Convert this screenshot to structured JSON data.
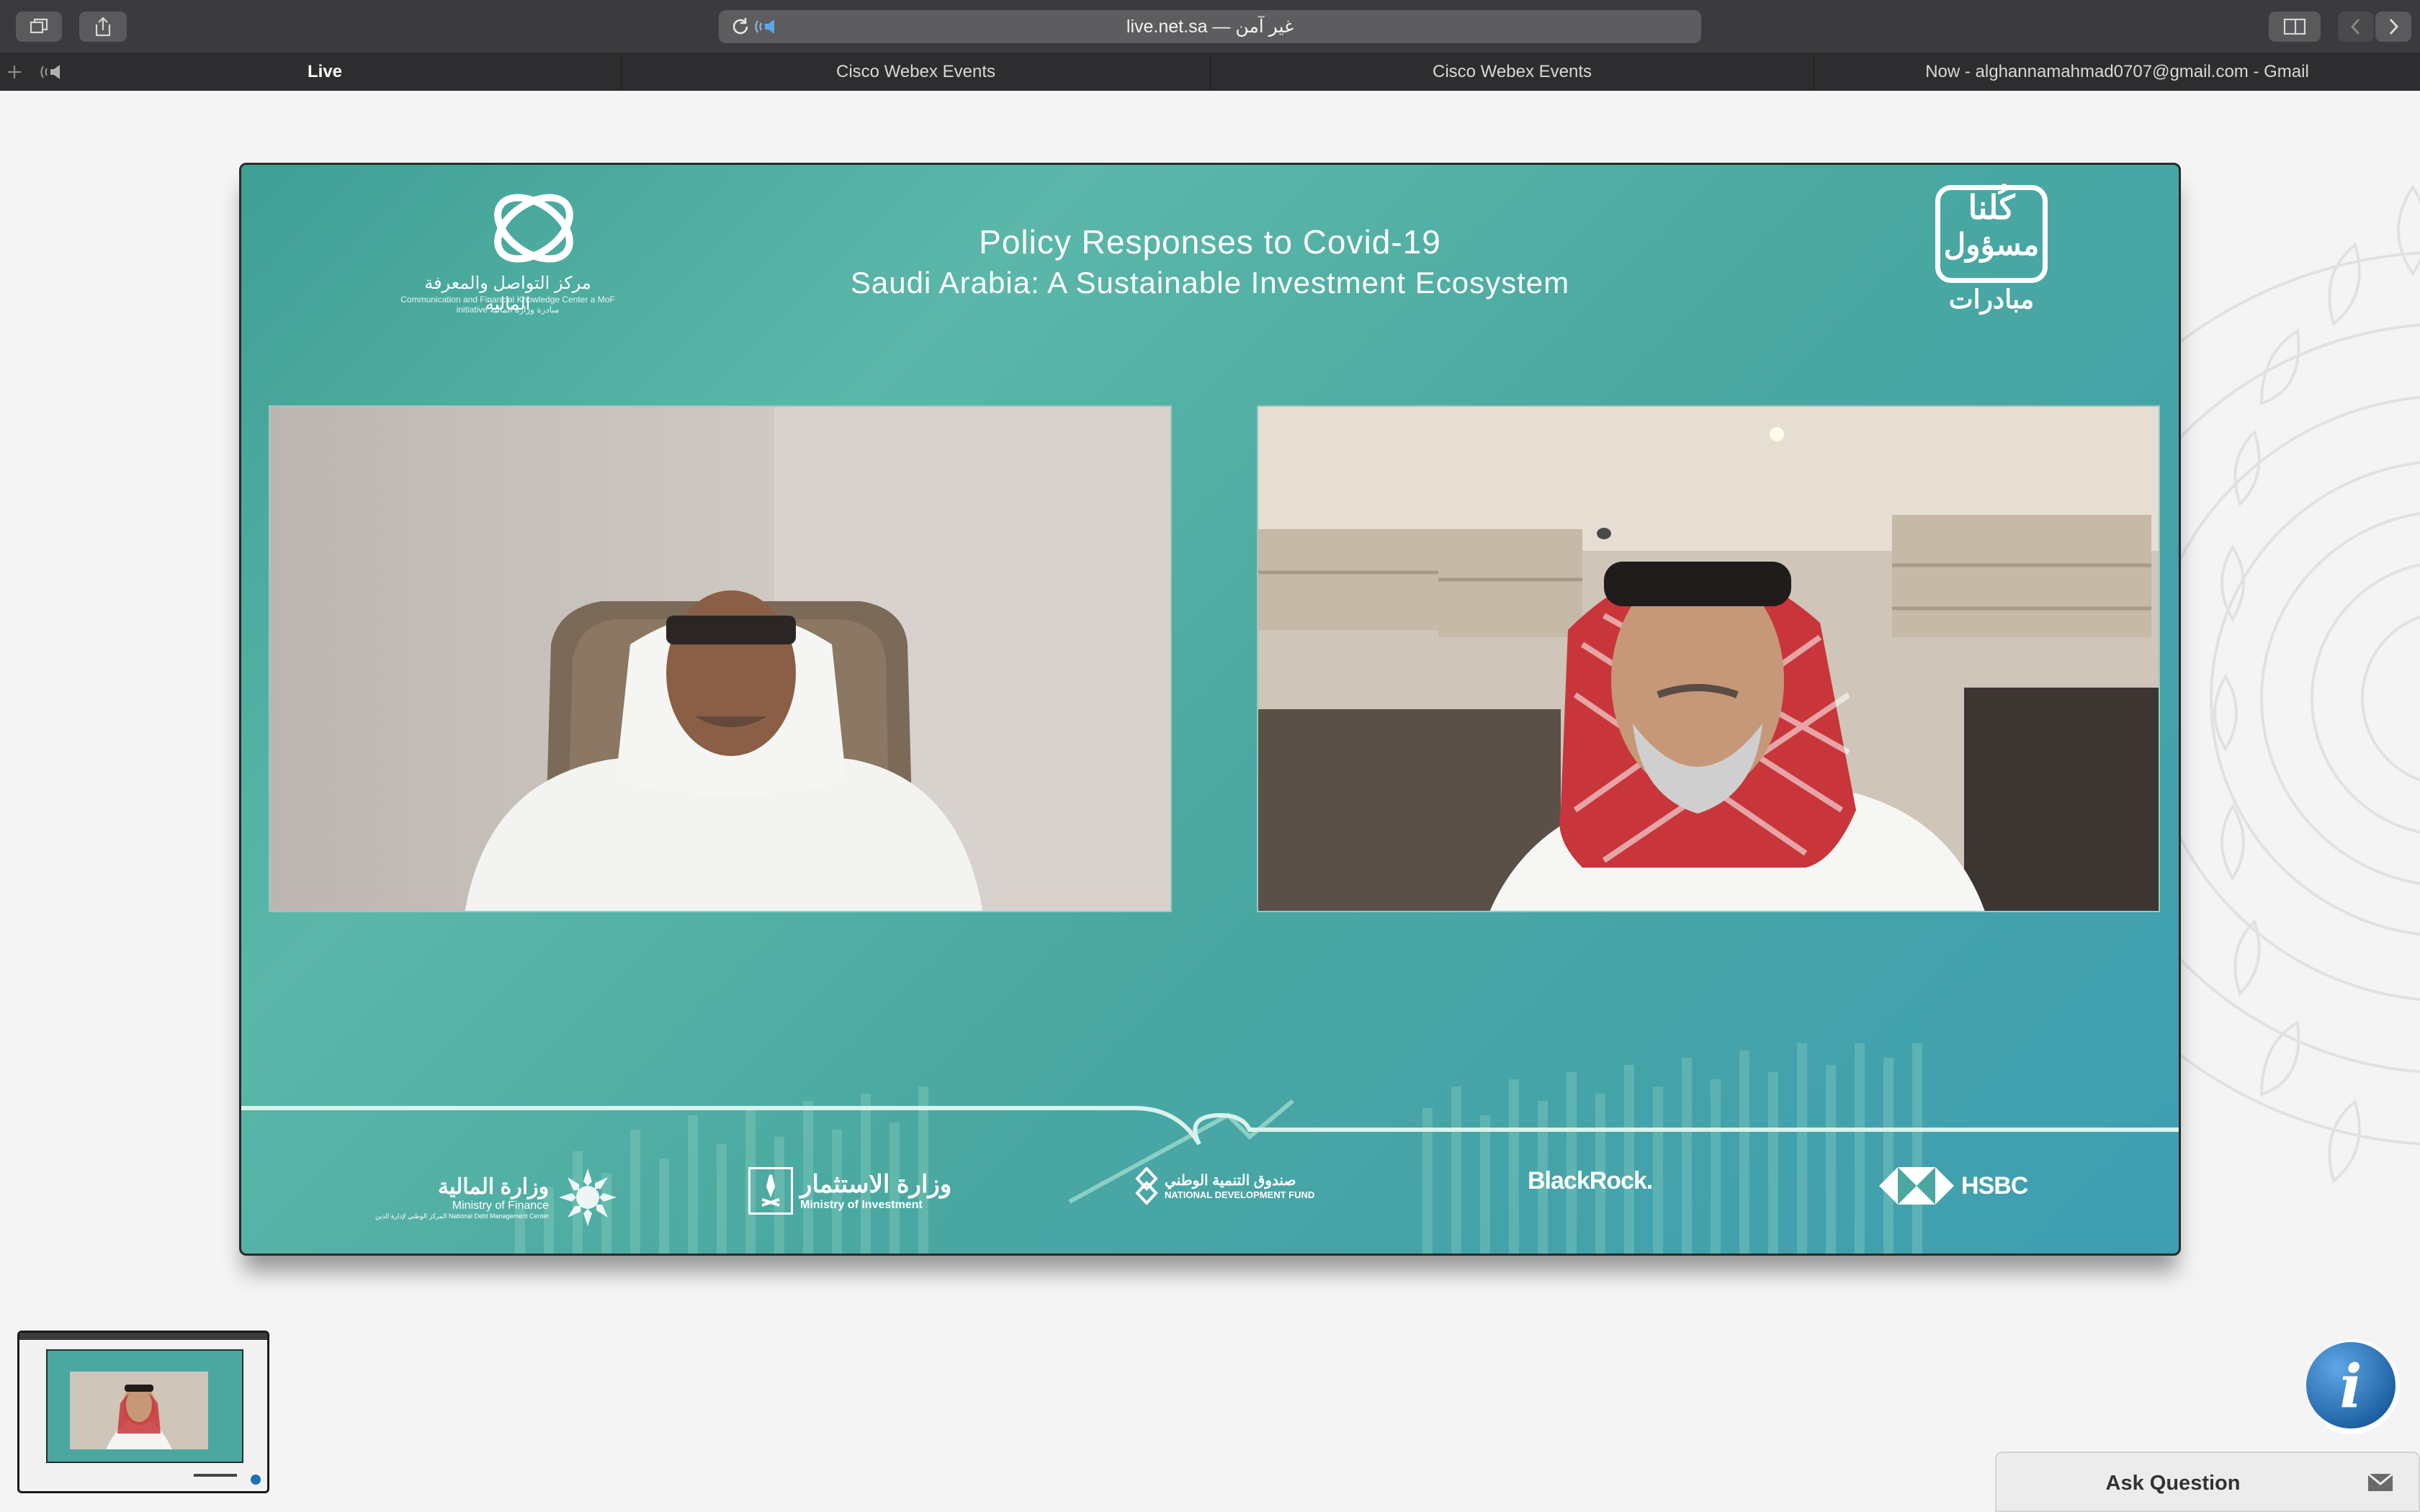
{
  "browser": {
    "address_text": "live.net.sa — غير آمن",
    "tabs": [
      {
        "label": "Live",
        "active": true
      },
      {
        "label": "Cisco Webex Events",
        "active": false
      },
      {
        "label": "Cisco Webex Events",
        "active": false
      },
      {
        "label": "Now - alghannamahmad0707@gmail.com - Gmail",
        "active": false
      }
    ]
  },
  "stream": {
    "title_line1": "Policy Responses to Covid-19",
    "title_line2": "Saudi Arabia: A Sustainable Investment Ecosystem",
    "top_left_logo": {
      "arabic": "مركز التواصل والمعرفة المالية",
      "english": "Communication and Financial Knowledge Center  a MoF initiative  مبادرة وزارة المالية"
    },
    "top_right_logo": {
      "line1": "كُلنا",
      "line2": "مسؤول",
      "line3": "مبادرات"
    },
    "partners": [
      {
        "arabic": "وزارة المالية",
        "english": "Ministry of Finance",
        "sub": "المركز الوطني لإدارة الدين  National Debt Management Center"
      },
      {
        "arabic": "وزارة الاستثمار",
        "english": "Ministry of Investment"
      },
      {
        "arabic": "صندوق التنمية الوطني",
        "english": "NATIONAL DEVELOPMENT FUND"
      },
      {
        "name": "BlackRock."
      },
      {
        "name": "HSBC"
      }
    ]
  },
  "widgets": {
    "ask_question": "Ask Question",
    "info_button_glyph": "i"
  },
  "colors": {
    "stage_teal": "#4aa8a1",
    "chrome_dark": "#3b3b3d",
    "info_blue": "#1f6fb5"
  }
}
